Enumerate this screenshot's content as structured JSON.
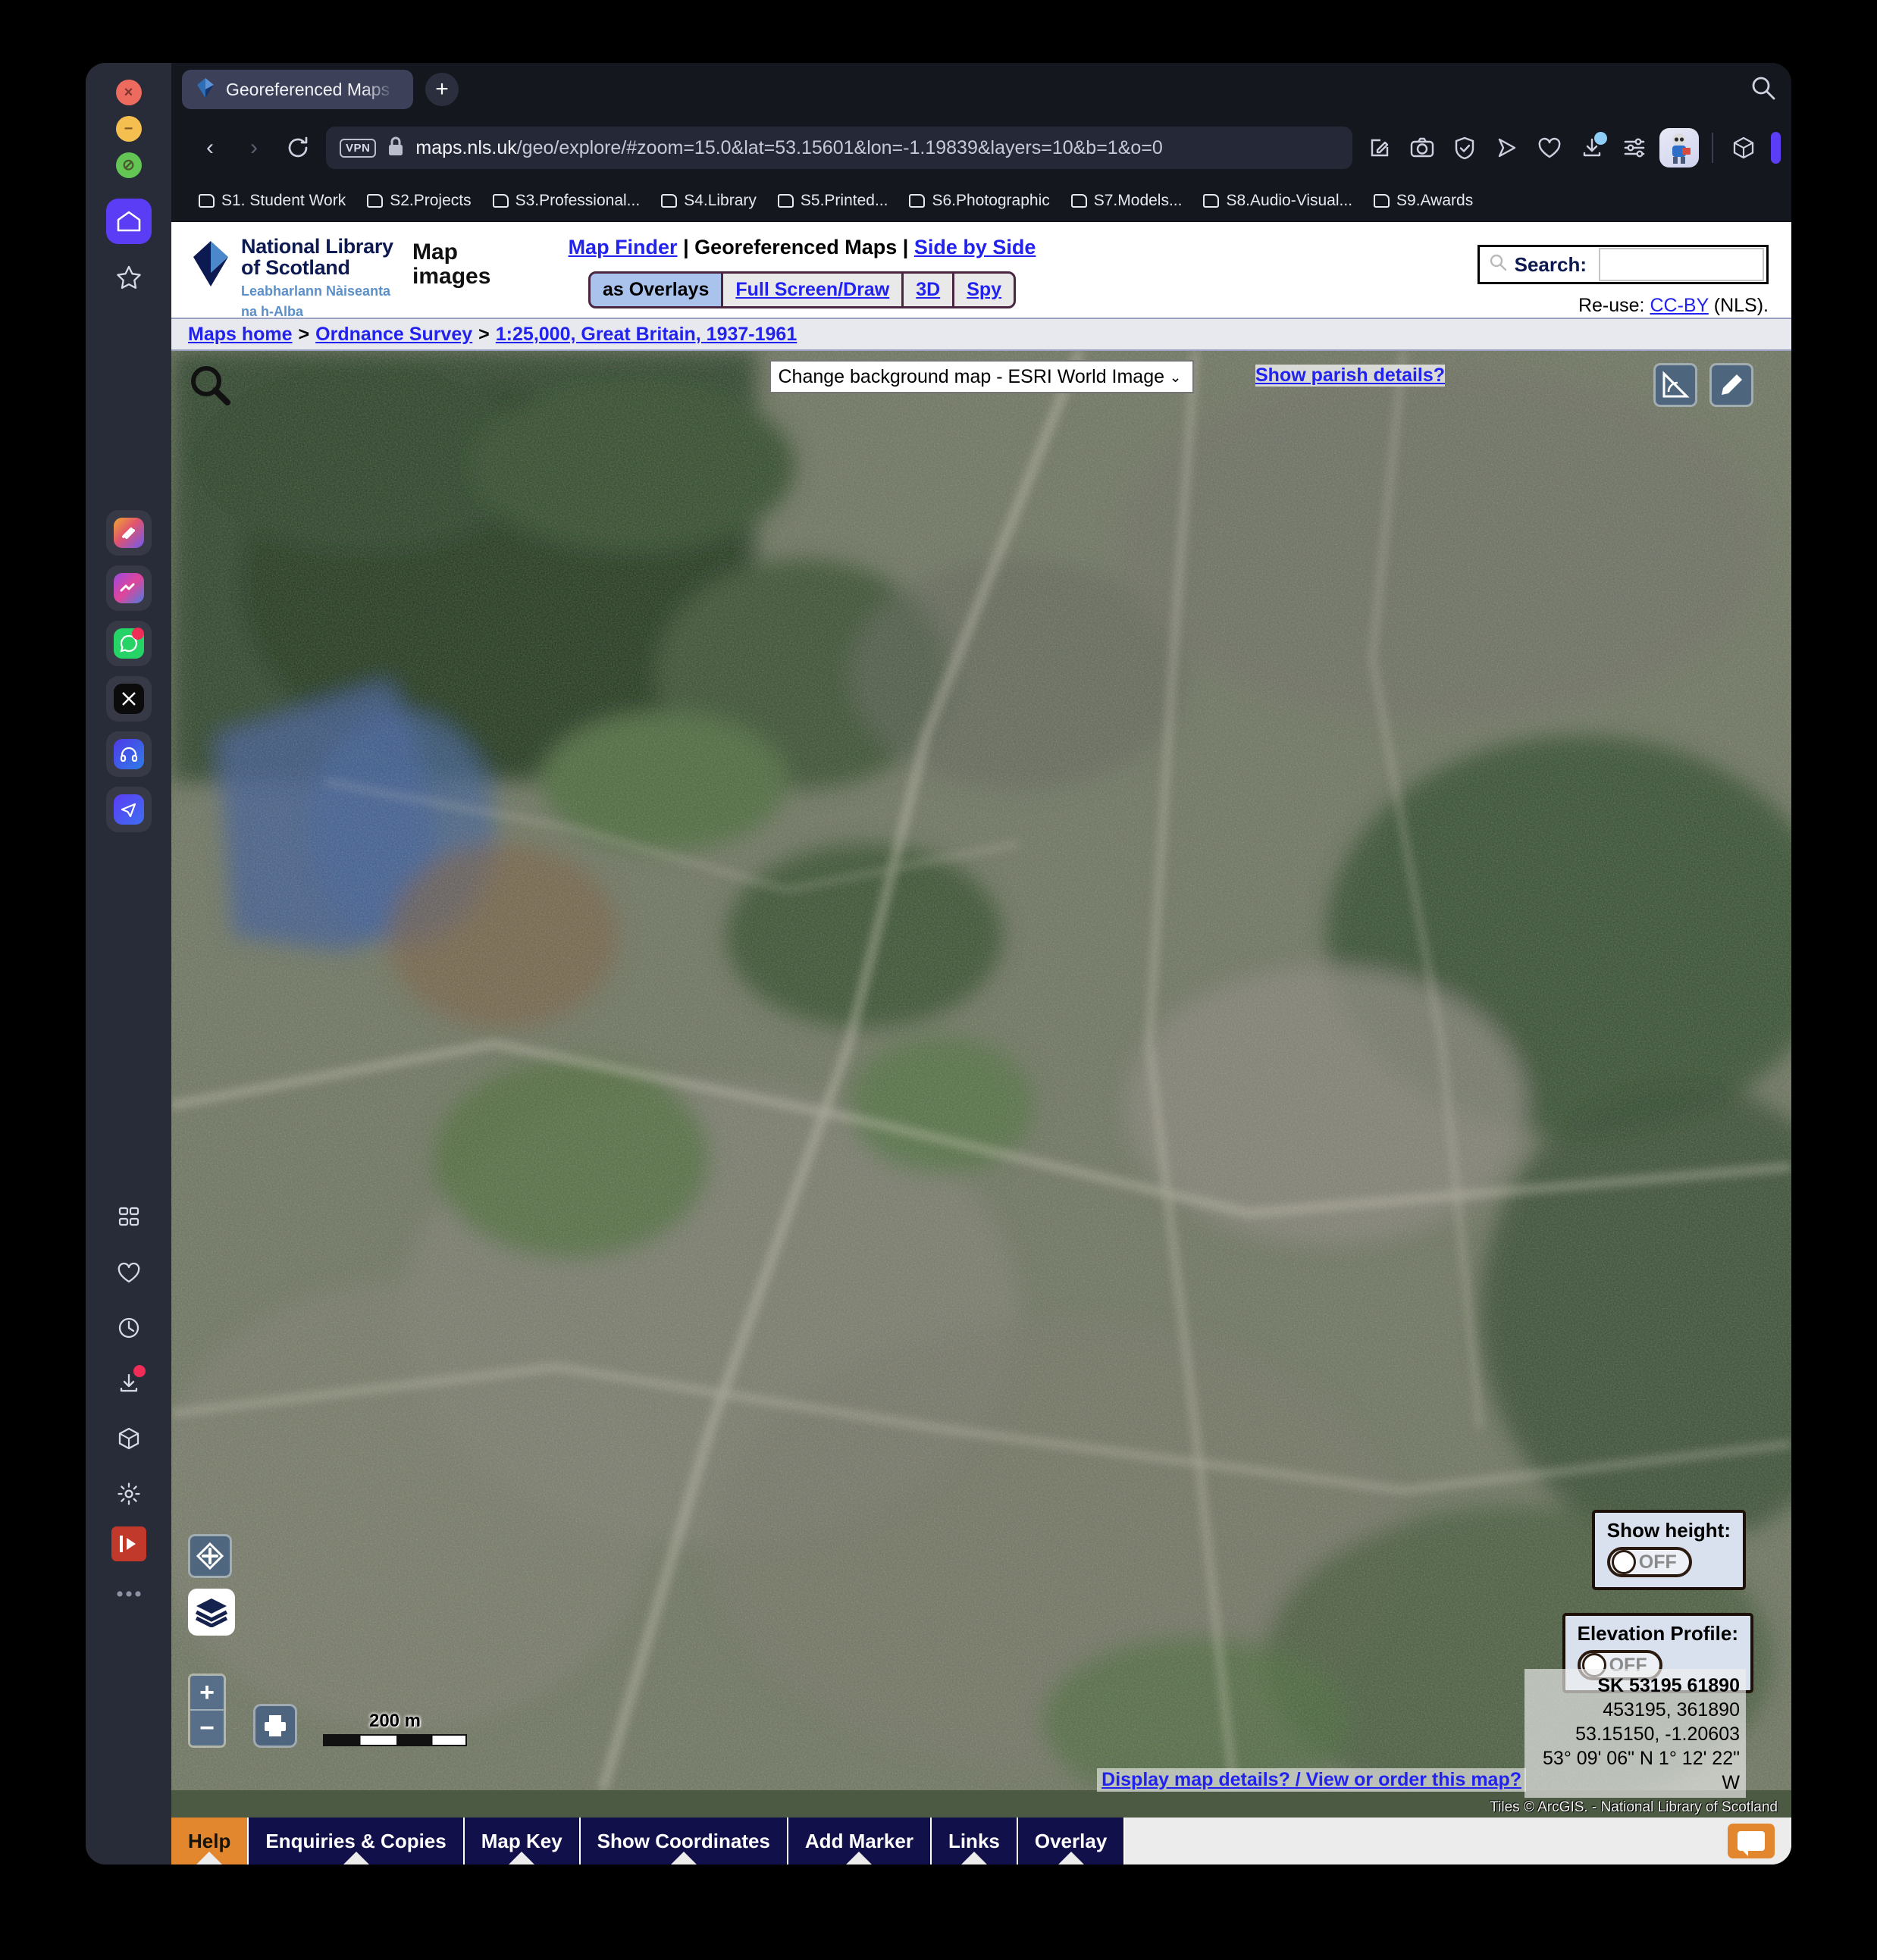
{
  "browser": {
    "tab": {
      "title": "Georeferenced Maps – M",
      "favicon": "nls-diamond-icon"
    },
    "newtab_label": "+",
    "url": {
      "host": "maps.nls.uk",
      "path": "/geo/explore/#zoom=15.0&lat=53.15601&lon=-1.19839&layers=10&b=1&o=0"
    },
    "vpn_label": "VPN",
    "toolbar_icons": [
      "edit-page-icon",
      "camera-icon",
      "shield-icon",
      "send-icon",
      "heart-icon",
      "download-icon",
      "sliders-icon",
      "avatar",
      "cube-icon"
    ],
    "bookmarks": [
      {
        "label": "S1. Student Work"
      },
      {
        "label": "S2.Projects"
      },
      {
        "label": "S3.Professional..."
      },
      {
        "label": "S4.Library"
      },
      {
        "label": "S5.Printed..."
      },
      {
        "label": "S6.Photographic"
      },
      {
        "label": "S7.Models..."
      },
      {
        "label": "S8.Audio-Visual..."
      },
      {
        "label": "S9.Awards"
      }
    ],
    "sidebar": {
      "top_items": [
        {
          "name": "home-icon",
          "active": true
        },
        {
          "name": "star-icon",
          "active": false
        }
      ],
      "apps": [
        {
          "name": "slack-icon"
        },
        {
          "name": "messenger-icon"
        },
        {
          "name": "whatsapp-icon",
          "badge": true
        },
        {
          "name": "x-twitter-icon"
        },
        {
          "name": "headphones-icon"
        },
        {
          "name": "telegram-icon"
        }
      ],
      "bottom_items": [
        {
          "name": "grid-apps-icon"
        },
        {
          "name": "heart-icon"
        },
        {
          "name": "history-clock-icon"
        },
        {
          "name": "download-icon",
          "badge": true
        },
        {
          "name": "cube-icon"
        },
        {
          "name": "gear-icon"
        },
        {
          "name": "video-player-icon"
        },
        {
          "name": "more-dots-icon"
        }
      ]
    }
  },
  "site": {
    "logo": {
      "line1": "National Library",
      "line2": "of Scotland",
      "gaelic1": "Leabharlann Nàiseanta",
      "gaelic2": "na h-Alba"
    },
    "section_title": "Map images",
    "top_links": {
      "map_finder": "Map Finder",
      "sep1": "|",
      "georeferenced": "Georeferenced Maps",
      "sep2": "|",
      "side_by_side": "Side by Side"
    },
    "mode_tabs": [
      {
        "label": "as Overlays",
        "active": true
      },
      {
        "label": "Full Screen/Draw",
        "active": false
      },
      {
        "label": "3D",
        "active": false
      },
      {
        "label": "Spy",
        "active": false
      }
    ],
    "search": {
      "label": "Search:",
      "value": "",
      "placeholder": ""
    },
    "reuse": {
      "prefix": "Re-use:",
      "link": "CC-BY",
      "suffix": "(NLS)."
    },
    "breadcrumb": {
      "home": "Maps home",
      "sep": ">",
      "series": "Ordnance Survey",
      "sheet": "1:25,000, Great Britain, 1937-1961"
    }
  },
  "map": {
    "background_select": {
      "value": "Change background map - ESRI World Image",
      "options": [
        "Change background map - ESRI World Image"
      ]
    },
    "parish_link": "Show parish details?",
    "tools": {
      "search_icon": "magnifier-icon",
      "measure_icon": "measure-tool-icon",
      "draw_icon": "pencil-icon",
      "recenter_icon": "recenter-icon",
      "layers_icon": "layers-icon",
      "print_icon": "printer-icon",
      "zoom_in": "+",
      "zoom_out": "−"
    },
    "scale": {
      "label": "200 m"
    },
    "show_height": {
      "title": "Show height:",
      "state": "OFF"
    },
    "elevation_profile": {
      "title": "Elevation Profile:",
      "state": "OFF"
    },
    "coordinates": {
      "grid_ref": "SK 53195 61890",
      "easting_northing": "453195, 361890",
      "lat_lon": "53.15150, -1.20603",
      "dms": "53° 09' 06\" N 1° 12' 22\" W"
    },
    "details_link": "Display map details? / View or order this map?",
    "attribution": "Tiles © ArcGIS. - National Library of Scotland"
  },
  "bottom_bar": {
    "buttons": [
      {
        "label": "Help",
        "highlight": true
      },
      {
        "label": "Enquiries & Copies",
        "highlight": false
      },
      {
        "label": "Map Key",
        "highlight": false
      },
      {
        "label": "Show Coordinates",
        "highlight": false
      },
      {
        "label": "Add Marker",
        "highlight": false
      },
      {
        "label": "Links",
        "highlight": false
      },
      {
        "label": "Overlay",
        "highlight": false
      }
    ],
    "chat_icon": "chat-bubble-icon"
  }
}
